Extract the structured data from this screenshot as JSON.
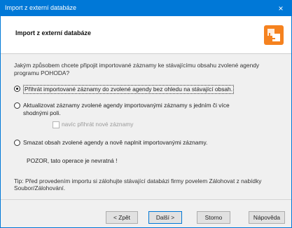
{
  "window": {
    "title": "Import z externí databáze",
    "close_glyph": "×"
  },
  "header": {
    "title": "Import z externí databáze",
    "logo_icon": "import-db-icon"
  },
  "question": "Jakým způsobem chcete připojit importované záznamy ke stávajícímu obsahu zvolené agendy programu POHODA?",
  "options": [
    {
      "label": "Přihrát importované záznamy do zvolené agendy bez ohledu na stávající obsah.",
      "selected": true
    },
    {
      "label_line1": "Aktualizovat záznamy zvolené agendy importovanými záznamy s jedním či více",
      "label_line2": "shodnými poli.",
      "selected": false
    },
    {
      "label": "Smazat obsah zvolené agendy a nově naplnit importovanými záznamy.",
      "selected": false
    }
  ],
  "checkbox": {
    "label": "navíc přihrát nové záznamy",
    "checked": false,
    "enabled": false
  },
  "warning": "POZOR, tato operace je nevratná !",
  "tip_line1": "Tip: Před provedením importu si zálohujte stávající databázi firmy povelem Zálohovat z nabídky",
  "tip_line2": "Soubor/Zálohování.",
  "buttons": {
    "back": "< Zpět",
    "next": "Další >",
    "cancel": "Storno",
    "help": "Nápověda"
  },
  "colors": {
    "titlebar": "#0078d7",
    "logo_orange": "#f5821f"
  }
}
